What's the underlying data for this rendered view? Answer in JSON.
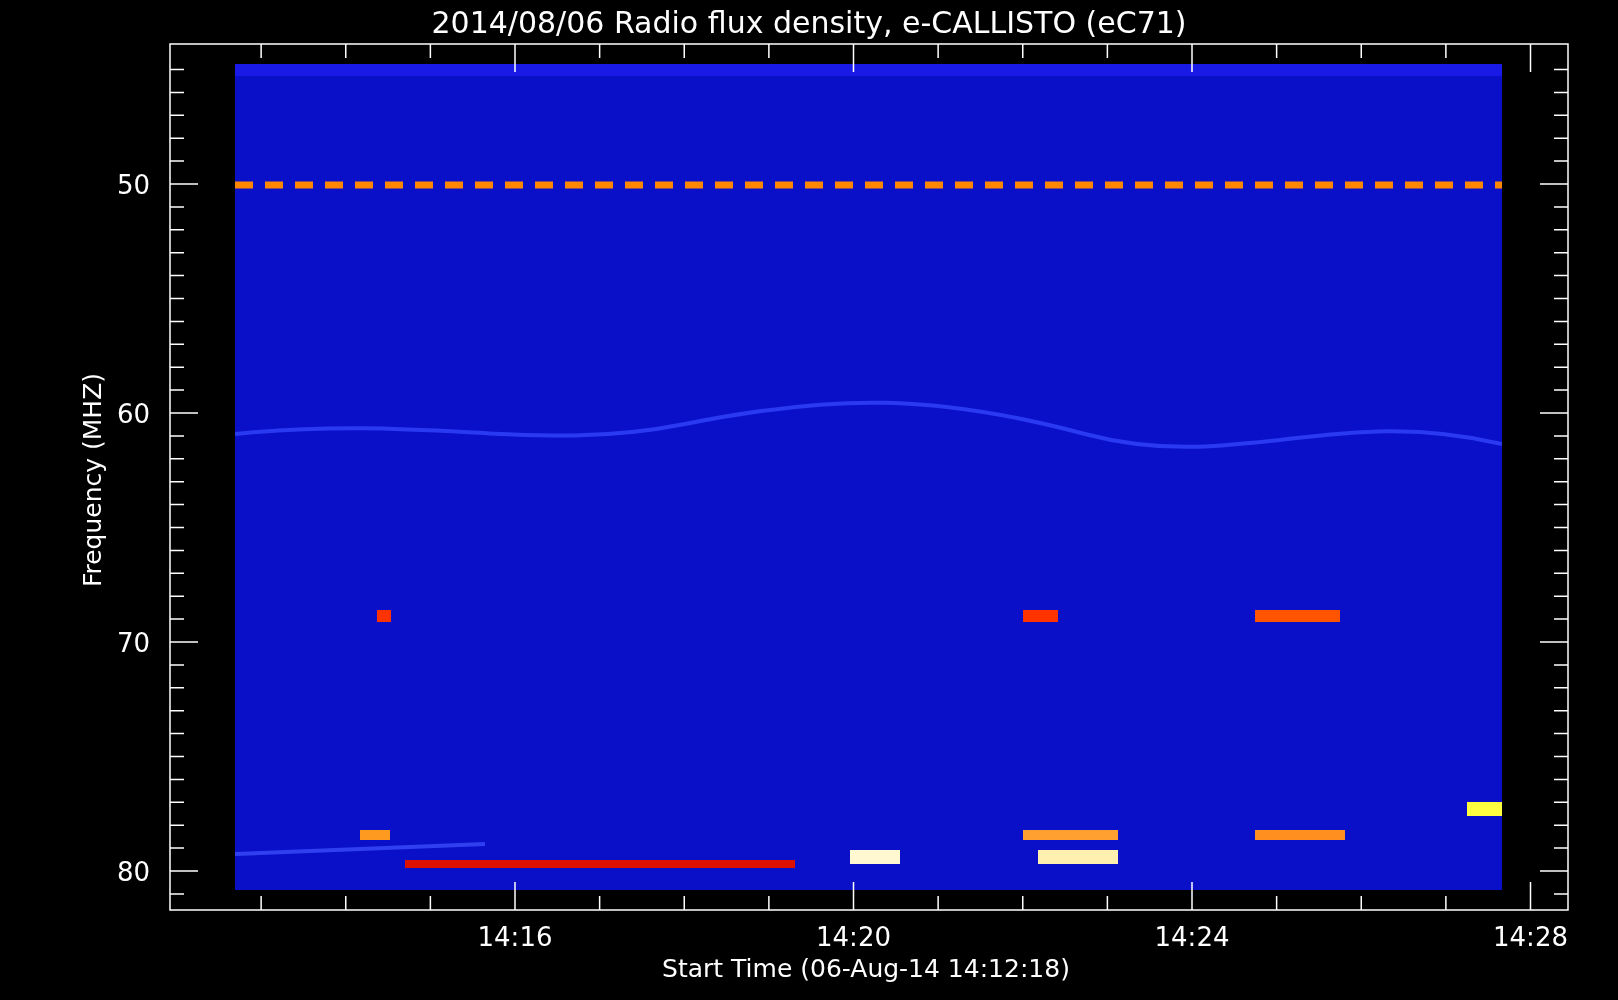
{
  "plot": {
    "title": "2014/08/06  Radio flux density, e-CALLISTO (eC71)",
    "kind": "spectrogram",
    "y_axis": {
      "label": "Frequency (MHZ)",
      "ticks": [
        "50",
        "60",
        "70",
        "80"
      ]
    },
    "x_axis": {
      "label": "Start Time (06-Aug-14 14:12:18)",
      "ticks": [
        "14:16",
        "14:20",
        "14:24",
        "14:28"
      ]
    }
  }
}
